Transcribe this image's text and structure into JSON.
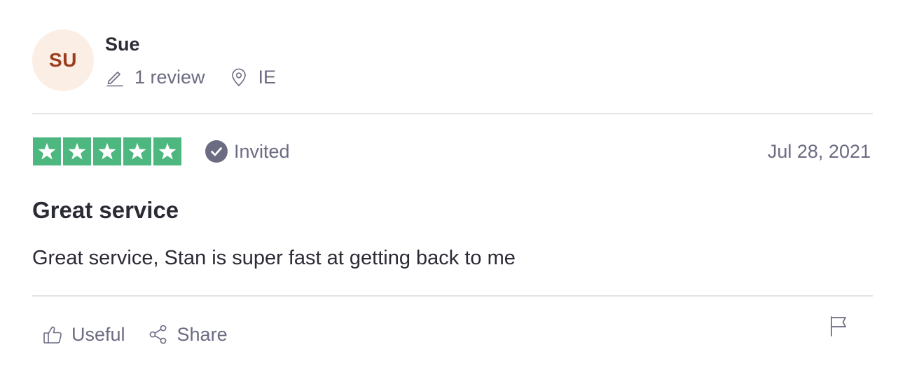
{
  "consumer": {
    "initials": "SU",
    "name": "Sue",
    "review_count": "1 review",
    "country": "IE"
  },
  "review": {
    "rating": 5,
    "rating_max": 5,
    "verification": "Invited",
    "date": "Jul 28, 2021",
    "title": "Great service",
    "text": "Great service, Stan is super fast at getting back to me"
  },
  "actions": {
    "useful_label": "Useful",
    "share_label": "Share"
  },
  "icons": {
    "reviews": "pencil-icon",
    "location": "location-pin-icon",
    "star": "star-icon",
    "verified": "check-circle-icon",
    "useful": "thumbs-up-icon",
    "share": "share-icon",
    "report": "flag-icon"
  },
  "colors": {
    "star_background": "#4cb77e",
    "avatar_background": "#fbeee5",
    "avatar_text": "#9b3c1c",
    "muted_text": "#6b6b82",
    "primary_text": "#2b2b36"
  }
}
